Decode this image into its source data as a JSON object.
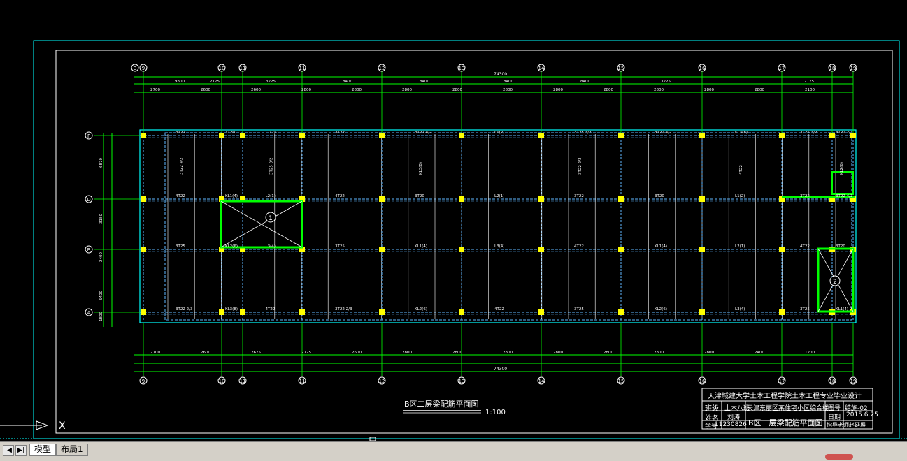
{
  "drawing": {
    "title": "B区二层梁配筋平面图",
    "scale": "1:100",
    "axes_top": [
      "9",
      "10",
      "11",
      "11",
      "12",
      "13",
      "14",
      "15",
      "16",
      "17",
      "18",
      "19"
    ],
    "axes_left": [
      "F",
      "D",
      "B",
      "A"
    ],
    "dim_total_top": "74300",
    "dim_total_bottom": "74300",
    "dim_row1": [
      "9300",
      "2175",
      "3225",
      "8400",
      "8400",
      "8400",
      "8400",
      "3225",
      "2175"
    ],
    "dim_row2": [
      "2700",
      "2600",
      "2600",
      "2800",
      "2800",
      "2800",
      "2800",
      "2800",
      "2800",
      "2800",
      "2800",
      "2800",
      "2800",
      "2100"
    ],
    "dim_row_bottom": [
      "2700",
      "2600",
      "2675",
      "2725",
      "2600",
      "2800",
      "2800",
      "2800",
      "2800",
      "2800",
      "2800",
      "2800",
      "2400",
      "1200"
    ],
    "dim_left": [
      "6870",
      "3180",
      "2400",
      "5400",
      "1800"
    ],
    "beam_tags": [
      "3T22",
      "4T22",
      "3T25",
      "3T22 2/3",
      "3T22 4/2",
      "3T20",
      "KL1(4)",
      "KL2(6)",
      "KL3(8)",
      "L1(2)",
      "L2(1)",
      "L3(4)",
      "4T22",
      "3T25 3/2"
    ],
    "circle_labels": [
      "1",
      "2"
    ]
  },
  "title_block": {
    "institution": "天津城建大学土木工程学院土木工程专业毕业设计",
    "class_label": "班级",
    "class_value": "土木八班",
    "name_label": "姓名",
    "name_value": "刘涛",
    "id_label": "学号",
    "id_value": "11230826",
    "project": "天津东丽区某住宅小区综合楼",
    "drawing_name": "B区二层梁配筋平面图",
    "drawing_no_label": "图号",
    "drawing_no_value": "结施-02",
    "date_label": "日期",
    "date_value": "2015.6.25",
    "advisor_label": "指导老师",
    "advisor_value": "赵延展"
  },
  "tabs": {
    "model": "模型",
    "layout1": "布局1"
  },
  "nav": {
    "first": "|◀",
    "last": "▶|"
  },
  "colors": {
    "background": "#000000",
    "frame": "#00ffff",
    "axis": "#00ff00",
    "column": "#ffff00",
    "text": "#ffffff",
    "highlight": "#00ff00"
  }
}
